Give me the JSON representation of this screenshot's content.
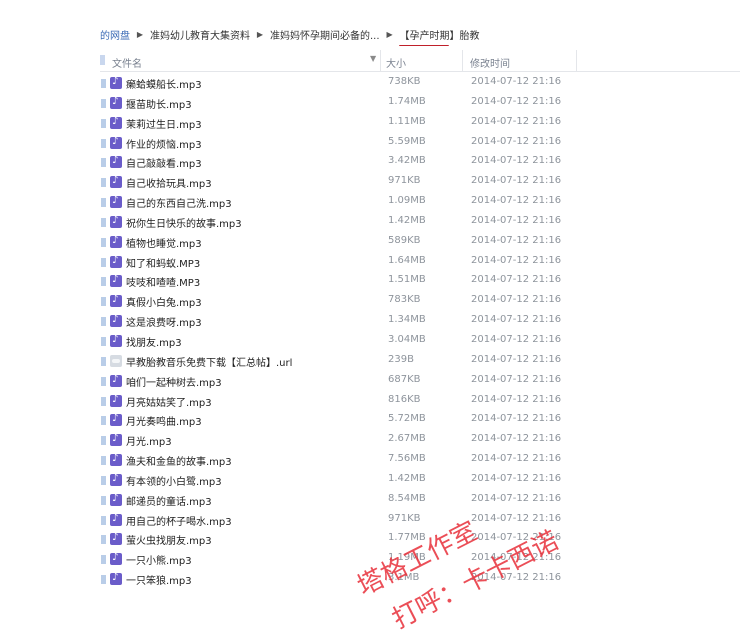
{
  "breadcrumb": [
    "的网盘",
    "准妈幼儿教育大集资料",
    "准妈妈怀孕期间必备的...",
    "【孕产时期】胎教"
  ],
  "columns": {
    "name": "文件名",
    "size": "大小",
    "modified": "修改时间"
  },
  "files": [
    {
      "name": "癞蛤蟆船长.mp3",
      "size": "738KB",
      "date": "2014-07-12 21:16",
      "type": "audio"
    },
    {
      "name": "揠苗助长.mp3",
      "size": "1.74MB",
      "date": "2014-07-12 21:16",
      "type": "audio"
    },
    {
      "name": "茉莉过生日.mp3",
      "size": "1.11MB",
      "date": "2014-07-12 21:16",
      "type": "audio"
    },
    {
      "name": "作业的烦恼.mp3",
      "size": "5.59MB",
      "date": "2014-07-12 21:16",
      "type": "audio"
    },
    {
      "name": "自己敲敲看.mp3",
      "size": "3.42MB",
      "date": "2014-07-12 21:16",
      "type": "audio"
    },
    {
      "name": "自己收拾玩具.mp3",
      "size": "971KB",
      "date": "2014-07-12 21:16",
      "type": "audio"
    },
    {
      "name": "自己的东西自己洗.mp3",
      "size": "1.09MB",
      "date": "2014-07-12 21:16",
      "type": "audio"
    },
    {
      "name": "祝你生日快乐的故事.mp3",
      "size": "1.42MB",
      "date": "2014-07-12 21:16",
      "type": "audio"
    },
    {
      "name": "植物也睡觉.mp3",
      "size": "589KB",
      "date": "2014-07-12 21:16",
      "type": "audio"
    },
    {
      "name": "知了和蚂蚁.MP3",
      "size": "1.64MB",
      "date": "2014-07-12 21:16",
      "type": "audio"
    },
    {
      "name": "吱吱和喳喳.MP3",
      "size": "1.51MB",
      "date": "2014-07-12 21:16",
      "type": "audio"
    },
    {
      "name": "真假小白兔.mp3",
      "size": "783KB",
      "date": "2014-07-12 21:16",
      "type": "audio"
    },
    {
      "name": "这是浪费呀.mp3",
      "size": "1.34MB",
      "date": "2014-07-12 21:16",
      "type": "audio"
    },
    {
      "name": "找朋友.mp3",
      "size": "3.04MB",
      "date": "2014-07-12 21:16",
      "type": "audio"
    },
    {
      "name": "早教胎教音乐免费下载【汇总帖】.url",
      "size": "239B",
      "date": "2014-07-12 21:16",
      "type": "url"
    },
    {
      "name": "咱们一起种树去.mp3",
      "size": "687KB",
      "date": "2014-07-12 21:16",
      "type": "audio"
    },
    {
      "name": "月亮姑姑笑了.mp3",
      "size": "816KB",
      "date": "2014-07-12 21:16",
      "type": "audio"
    },
    {
      "name": "月光奏鸣曲.mp3",
      "size": "5.72MB",
      "date": "2014-07-12 21:16",
      "type": "audio"
    },
    {
      "name": "月光.mp3",
      "size": "2.67MB",
      "date": "2014-07-12 21:16",
      "type": "audio"
    },
    {
      "name": "渔夫和金鱼的故事.mp3",
      "size": "7.56MB",
      "date": "2014-07-12 21:16",
      "type": "audio"
    },
    {
      "name": "有本领的小白鹭.mp3",
      "size": "1.42MB",
      "date": "2014-07-12 21:16",
      "type": "audio"
    },
    {
      "name": "邮递员的童话.mp3",
      "size": "8.54MB",
      "date": "2014-07-12 21:16",
      "type": "audio"
    },
    {
      "name": "用自己的杯子喝水.mp3",
      "size": "971KB",
      "date": "2014-07-12 21:16",
      "type": "audio"
    },
    {
      "name": "萤火虫找朋友.mp3",
      "size": "1.77MB",
      "date": "2014-07-12 21:16",
      "type": "audio"
    },
    {
      "name": "一只小熊.mp3",
      "size": "1.19MB",
      "date": "2014-07-12 21:16",
      "type": "audio"
    },
    {
      "name": "一只笨狼.mp3",
      "size": "3.1MB",
      "date": "2014-07-12 21:16",
      "type": "audio"
    }
  ],
  "watermark": [
    "塔格工作室",
    "打呼：卡卡西诺"
  ],
  "colors": {
    "underline": "#c0202a",
    "audio_icon": "#6a5cc9",
    "watermark": "#e8303a"
  }
}
